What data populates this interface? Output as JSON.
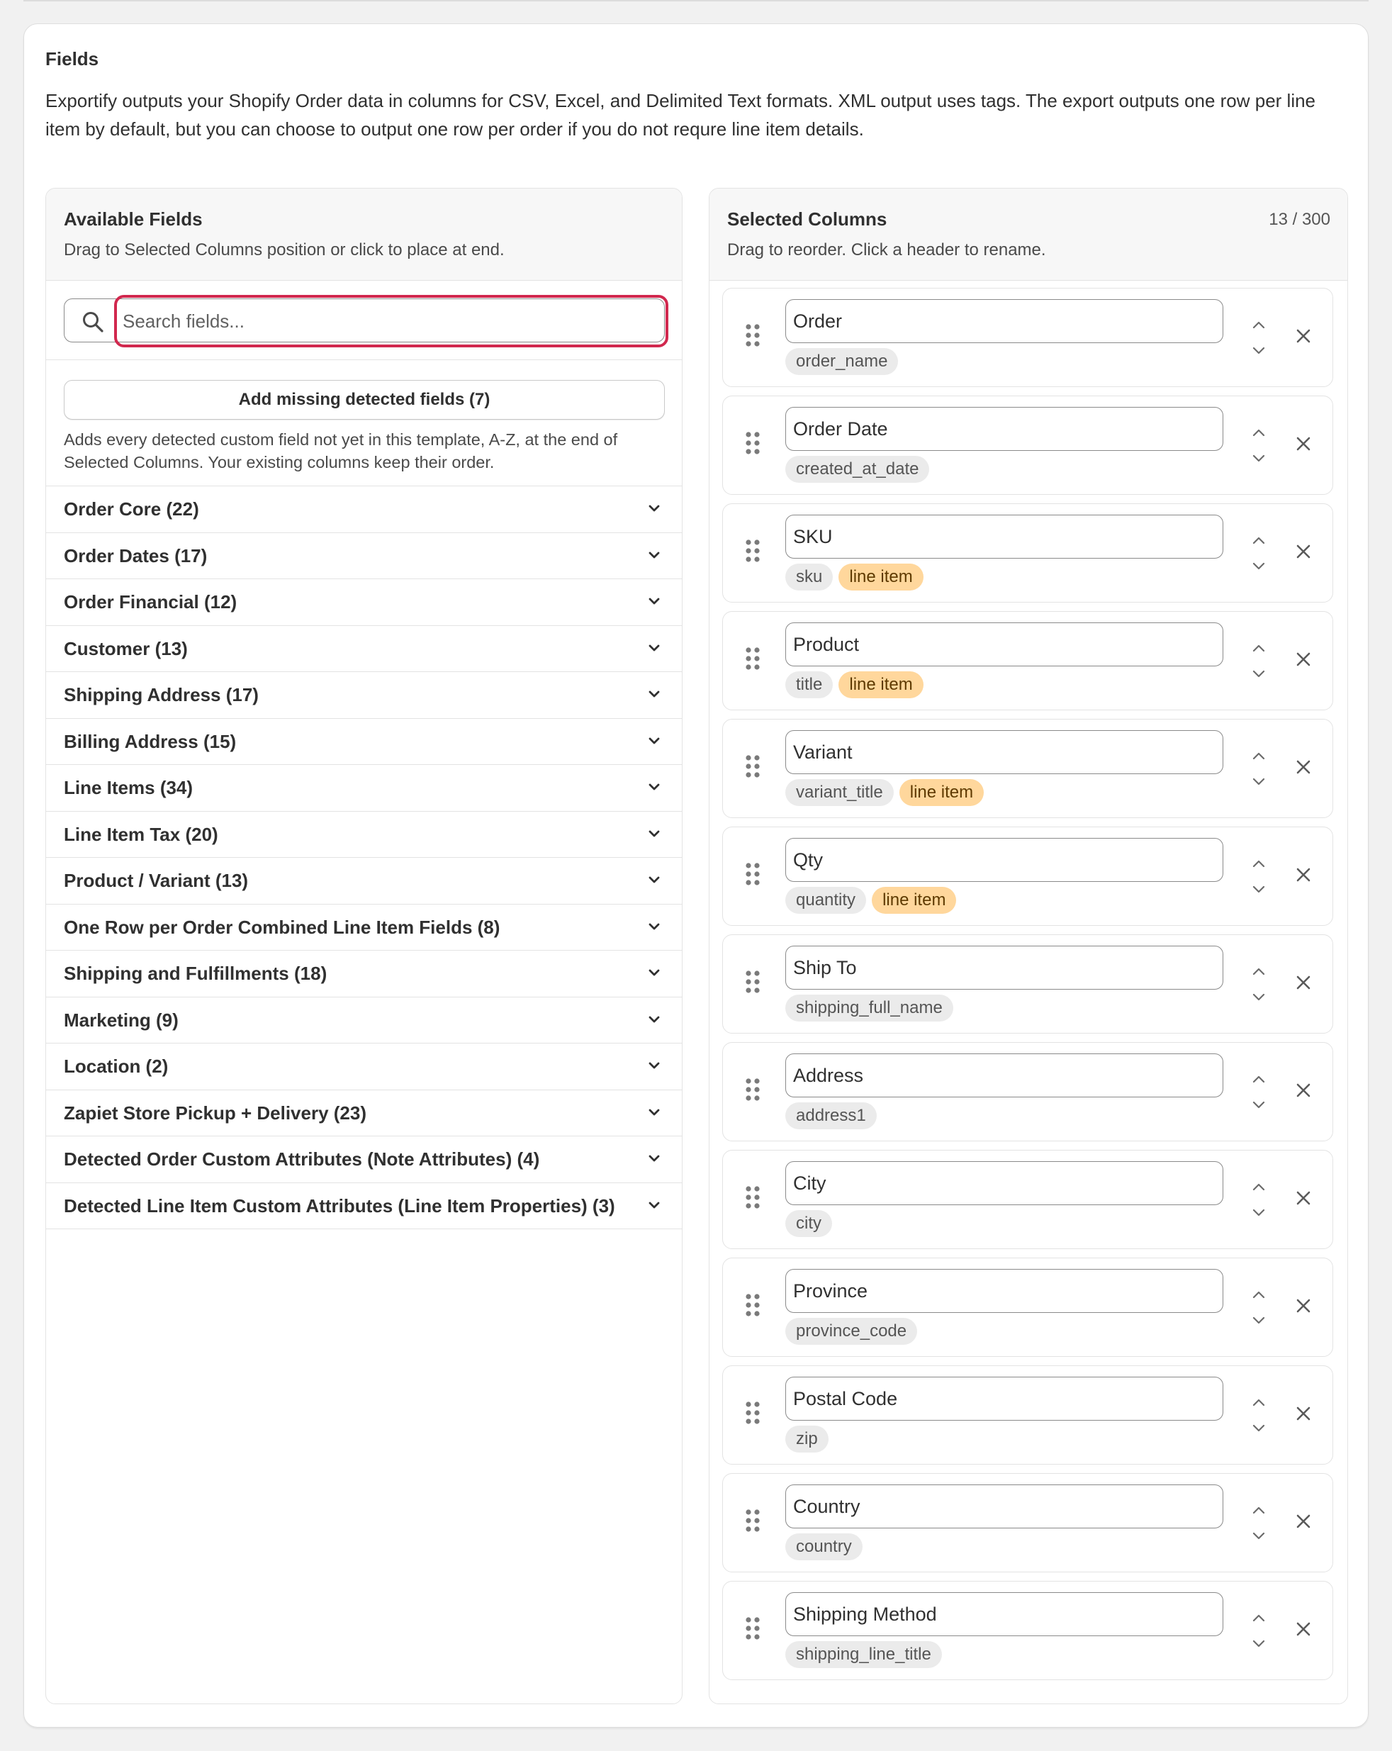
{
  "card": {
    "title": "Fields",
    "description": "Exportify outputs your Shopify Order data in columns for CSV, Excel, and Delimited Text formats. XML output uses tags. The export outputs one row per line item by default, but you can choose to output one row per order if you do not requre line item details."
  },
  "available": {
    "title": "Available Fields",
    "subtitle": "Drag to Selected Columns position or click to place at end.",
    "search_placeholder": "Search fields...",
    "search_value": "",
    "add_missing_label": "Add missing detected fields (7)",
    "add_missing_note": "Adds every detected custom field not yet in this template, A-Z, at the end of Selected Columns. Your existing columns keep their order.",
    "categories": [
      "Order Core (22)",
      "Order Dates (17)",
      "Order Financial (12)",
      "Customer (13)",
      "Shipping Address (17)",
      "Billing Address (15)",
      "Line Items (34)",
      "Line Item Tax (20)",
      "Product / Variant (13)",
      "One Row per Order Combined Line Item Fields (8)",
      "Shipping and Fulfillments (18)",
      "Marketing (9)",
      "Location (2)",
      "Zapiet Store Pickup + Delivery (23)",
      "Detected Order Custom Attributes (Note Attributes) (4)",
      "Detected Line Item Custom Attributes (Line Item Properties) (3)"
    ]
  },
  "selected": {
    "title": "Selected Columns",
    "subtitle": "Drag to reorder. Click a header to rename.",
    "count": "13 / 300",
    "line_item_tag": "line item",
    "columns": [
      {
        "name": "Order",
        "field": "order_name",
        "line_item": false
      },
      {
        "name": "Order Date",
        "field": "created_at_date",
        "line_item": false
      },
      {
        "name": "SKU",
        "field": "sku",
        "line_item": true
      },
      {
        "name": "Product",
        "field": "title",
        "line_item": true
      },
      {
        "name": "Variant",
        "field": "variant_title",
        "line_item": true
      },
      {
        "name": "Qty",
        "field": "quantity",
        "line_item": true
      },
      {
        "name": "Ship To",
        "field": "shipping_full_name",
        "line_item": false
      },
      {
        "name": "Address",
        "field": "address1",
        "line_item": false
      },
      {
        "name": "City",
        "field": "city",
        "line_item": false
      },
      {
        "name": "Province",
        "field": "province_code",
        "line_item": false
      },
      {
        "name": "Postal Code",
        "field": "zip",
        "line_item": false
      },
      {
        "name": "Country",
        "field": "country",
        "line_item": false
      },
      {
        "name": "Shipping Method",
        "field": "shipping_line_title",
        "line_item": false
      }
    ]
  },
  "colors": {
    "focus_ring": "#d1284e",
    "line_item_tag_bg": "#ffd79c",
    "field_tag_bg": "#ebebeb"
  },
  "icons": {
    "search": "search-icon",
    "chevron": "chevron-down-icon",
    "drag": "drag-handle-icon",
    "move_up": "chevron-up-icon",
    "move_down": "chevron-down-icon",
    "remove": "close-icon"
  }
}
